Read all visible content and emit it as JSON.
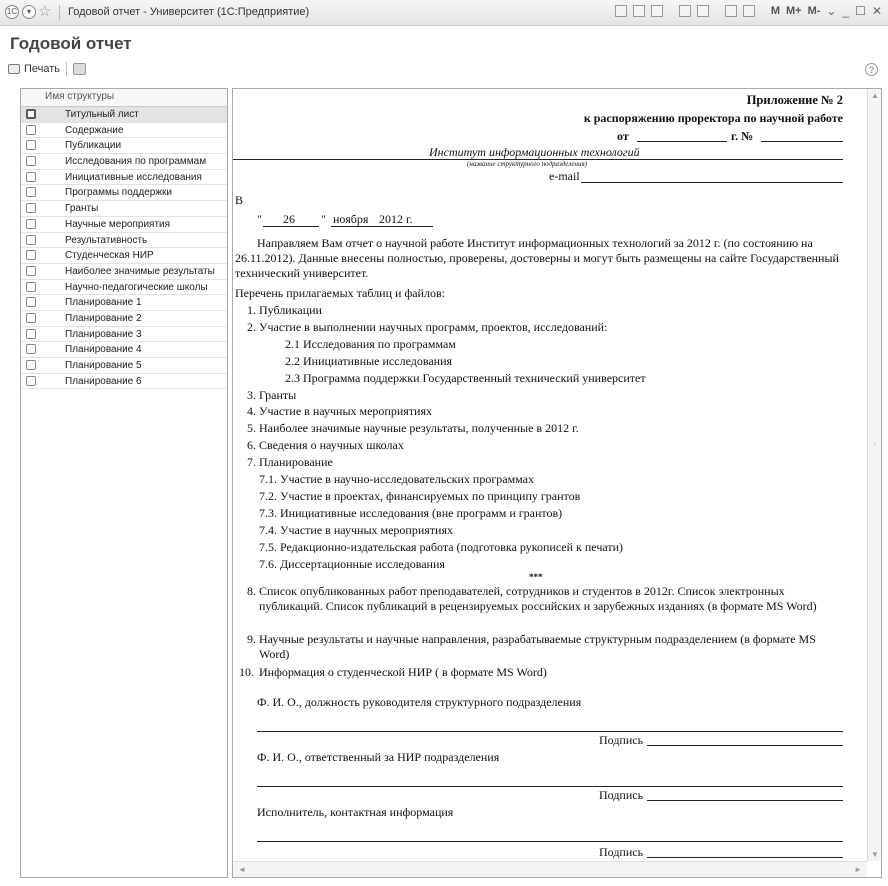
{
  "window": {
    "title": "Годовой отчет - Университет  (1С:Предприятие)",
    "heading": "Годовой отчет",
    "memory_buttons": [
      "M",
      "M+",
      "M-"
    ]
  },
  "toolbar": {
    "print_label": "Печать",
    "help_label": "?"
  },
  "structure_list": {
    "header": "Имя структуры",
    "items": [
      "Титульный лист",
      "Содержание",
      "Публикации",
      "Исследования по программам",
      "Инициативные исследования",
      "Программы поддержки",
      "Гранты",
      "Научные мероприятия",
      "Результативность",
      "Студенческая НИР",
      "Наиболее значимые результаты",
      "Научно-педагогические школы",
      "Планирование 1",
      "Планирование 2",
      "Планирование 3",
      "Планирование 4",
      "Планирование 5",
      "Планирование 6"
    ],
    "selected_index": 0
  },
  "document": {
    "appendix": "Приложение № 2",
    "order_line": "к распоряжению проректора по научной работе",
    "from_label": "от",
    "year_label": "г. №",
    "institute": "Институт информационных технологий",
    "institute_caption": "(название структурного подразделения)",
    "email_label": "e-mail",
    "to_label": "В",
    "date_quote_open": "\"",
    "date_day": "26",
    "date_quote_close": "\"",
    "date_month": "ноября",
    "date_year": "2012 г.",
    "intro_paragraph": "Направляем Вам отчет о научной работе Институт информационных технологий за 2012 г. (по состоянию на 26.11.2012). Данные внесены полностью, проверены, достоверны и могут быть размещены на сайте Государственный технический университет.",
    "list_title": "Перечень прилагаемых таблиц и файлов:",
    "items": [
      {
        "num": "1.",
        "text": "Публикации",
        "level": 0
      },
      {
        "num": "2.",
        "text": "Участие в выполнении научных программ, проектов, исследований:",
        "level": 0
      },
      {
        "num": "",
        "text": "2.1 Исследования по программам",
        "level": 1
      },
      {
        "num": "",
        "text": "2.2 Инициативные исследования",
        "level": 1
      },
      {
        "num": "",
        "text": "2.3 Программа поддержки Государственный технический университет",
        "level": 1
      },
      {
        "num": "3.",
        "text": "Гранты",
        "level": 0
      },
      {
        "num": "4.",
        "text": "Участие в научных мероприятиях",
        "level": 0
      },
      {
        "num": "5.",
        "text": "Наиболее значимые научные результаты, полученные в 2012 г.",
        "level": 0
      },
      {
        "num": "6.",
        "text": "Сведения о научных школах",
        "level": 0
      },
      {
        "num": "7.",
        "text": "Планирование",
        "level": 0
      },
      {
        "num": "",
        "text": "7.1. Участие в научно-исследовательских программах",
        "level": 2
      },
      {
        "num": "",
        "text": "7.2. Участие в проектах, финансируемых по принципу грантов",
        "level": 2
      },
      {
        "num": "",
        "text": "7.3. Инициативные исследования (вне программ и грантов)",
        "level": 2
      },
      {
        "num": "",
        "text": "7.4. Участие в научных мероприятиях",
        "level": 2
      },
      {
        "num": "",
        "text": "7.5. Редакционно-издательская работа (подготовка рукописей к печати)",
        "level": 2
      },
      {
        "num": "",
        "text": "7.6. Диссертационные исследования",
        "level": 2
      }
    ],
    "stars": "***",
    "item8_num": "8.",
    "item8": "Список опубликованных работ преподавателей, сотрудников и студентов в 2012г. Список электронных публикаций. Список публикаций в рецензируемых российских и зарубежных  изданиях (в формате MS Word)",
    "item9_num": "9.",
    "item9": "Научные результаты и научные направления, разрабатываемые структурным подразделением (в формате MS Word)",
    "item10_num": "10.",
    "item10": "Информация о студенческой НИР ( в формате MS  Word)",
    "head_label": "Ф. И. О., должность руководителя структурного подразделения",
    "signature_label": "Подпись",
    "responsible_label": "Ф. И. О., ответственный за НИР подразделения",
    "executor_label": "Исполнитель, контактная информация"
  }
}
